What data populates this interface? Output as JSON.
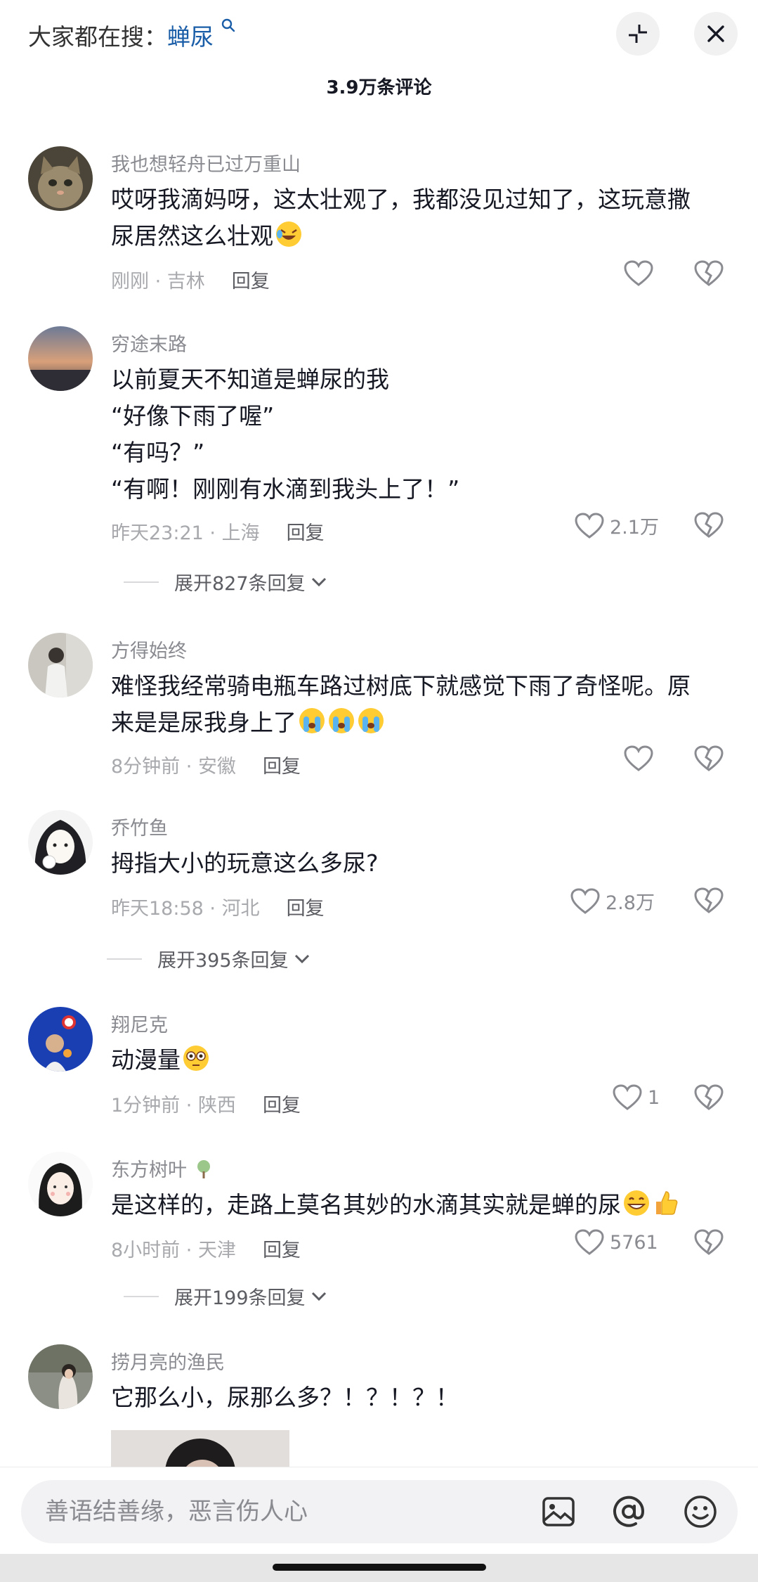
{
  "header": {
    "search_prefix": "大家都在搜：",
    "search_keyword": "蝉尿",
    "comment_count_title": "3.9万条评论"
  },
  "comments": [
    {
      "username": "我也想轻舟已过万重山",
      "lines": [
        "哎呀我滴妈呀，这太壮观了，我都没见过知了，这玩意撒",
        "尿居然这么壮观"
      ],
      "emojis": [
        "rofl-emoji"
      ],
      "time": "刚刚",
      "location": "吉林",
      "reply": "回复",
      "likes": ""
    },
    {
      "username": "穷途末路",
      "lines": [
        "以前夏天不知道是蝉尿的我",
        "“好像下雨了喔”",
        "“有吗？”",
        "“有啊！刚刚有水滴到我头上了！”"
      ],
      "time": "昨天23:21",
      "location": "上海",
      "reply": "回复",
      "likes": "2.1万",
      "expand": "展开827条回复"
    },
    {
      "username": "方得始终",
      "lines": [
        "难怪我经常骑电瓶车路过树底下就感觉下雨了奇怪呢。原",
        "来是是尿我身上了"
      ],
      "emojis": [
        "crying-emoji",
        "crying-emoji",
        "crying-emoji"
      ],
      "time": "8分钟前",
      "location": "安徽",
      "reply": "回复",
      "likes": ""
    },
    {
      "username": "乔竹鱼",
      "lines": [
        "拇指大小的玩意这么多尿?"
      ],
      "time": "昨天18:58",
      "location": "河北",
      "reply": "回复",
      "likes": "2.8万",
      "expand": "展开395条回复"
    },
    {
      "username": "翔尼克",
      "lines": [
        "动漫量"
      ],
      "emojis": [
        "flushed-emoji"
      ],
      "time": "1分钟前",
      "location": "陕西",
      "reply": "回复",
      "likes": "1"
    },
    {
      "username": "东方树叶",
      "lines": [
        "是这样的，走路上莫名其妙的水滴其实就是蝉的尿"
      ],
      "emojis": [
        "grin-emoji",
        "thumbs-up-emoji"
      ],
      "time": "8小时前",
      "location": "天津",
      "reply": "回复",
      "likes": "5761",
      "expand": "展开199条回复"
    },
    {
      "username": "捞月亮的渔民",
      "lines": [
        "它那么小，尿那么多？！？！？！"
      ]
    }
  ],
  "input": {
    "placeholder": "善语结善缘，恶言伤人心"
  },
  "colors": {
    "keyword_blue": "#1b5ea8",
    "username_gray": "#8a8b91",
    "meta_gray": "#a8a9ad",
    "text": "#161823"
  }
}
